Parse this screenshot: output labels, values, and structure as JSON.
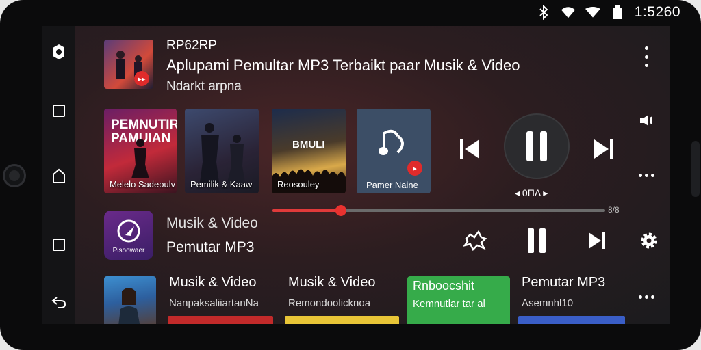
{
  "status_bar": {
    "clock": "1:5260",
    "icons": [
      "bluetooth-icon",
      "wifi-icon",
      "signal-icon",
      "battery-icon"
    ]
  },
  "rail": {
    "items": [
      "settings-icon",
      "square-icon",
      "home-icon",
      "recents-icon",
      "back-icon"
    ]
  },
  "header": {
    "subtitle": "RP62RP",
    "title": "Aplupami Pemultar MP3 Terbaikt paar Musik & Video",
    "artist": "Ndarkt arpna"
  },
  "cards": [
    {
      "big_text": "PEMNUTIR PAMUIAN",
      "label": "Melelo Sadeoulv"
    },
    {
      "label": "Pemilik & Kaaw"
    },
    {
      "big_text": "BMULI",
      "label": "Reosouley"
    },
    {
      "label": "Pamer Naine"
    }
  ],
  "player": {
    "time_mid": "◂ 0ΠΛ ▸",
    "time_end": "8/8",
    "progress_fraction": 0.205
  },
  "app": {
    "icon_label": "Pisoowaer",
    "line1": "Musik & Video",
    "line2": "Pemutar MP3"
  },
  "bottom": [
    {
      "title": "Musik & Video",
      "sub": "NanpaksaliiartanNa",
      "bar_color": "#c22a2a"
    },
    {
      "title": "Musik & Video",
      "sub": "Remondoolicknoa",
      "bar_color": "#e8c537"
    },
    {
      "title": "Rnboocshit",
      "sub": "Kemnutlar tar al",
      "bar_color": "#36ab4a"
    },
    {
      "title": "Pemutar MP3",
      "sub": "Asemnhl10",
      "bar_color": "#3a5ec7"
    }
  ],
  "colors": {
    "accent": "#e8322f",
    "green": "#36ab4a"
  }
}
